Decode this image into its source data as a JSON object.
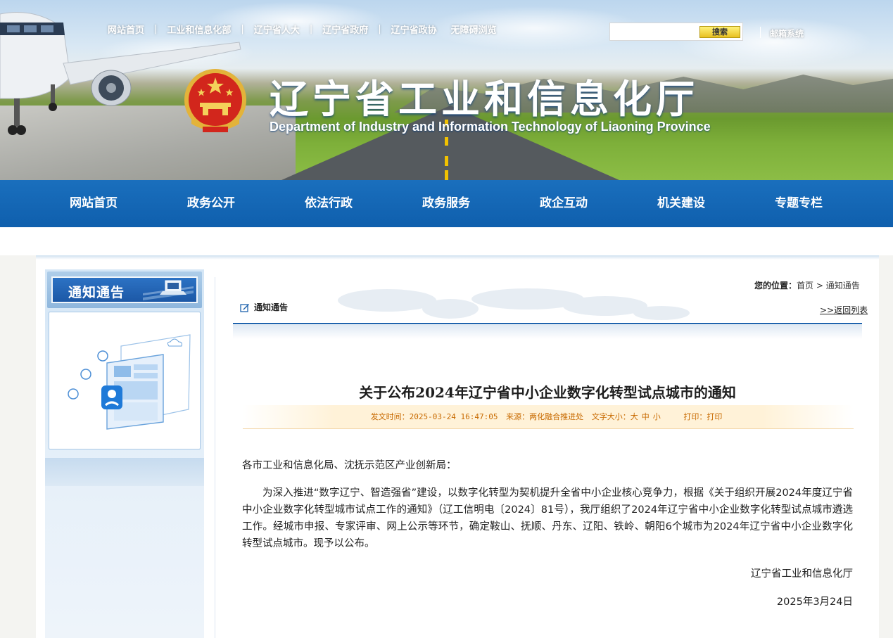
{
  "top_links": [
    "网站首页",
    "工业和信息化部",
    "辽宁省人大",
    "辽宁省政府",
    "辽宁省政协",
    "无障碍浏览"
  ],
  "search": {
    "placeholder": "",
    "button": "搜索"
  },
  "mail_link": "邮箱系统",
  "site_title_cn": "辽宁省工业和信息化厅",
  "site_title_en": "Department of Industry and Information Technology of Liaoning Province",
  "main_nav": [
    "网站首页",
    "政务公开",
    "依法行政",
    "政务服务",
    "政企互动",
    "机关建设",
    "专题专栏"
  ],
  "sidebar": {
    "title": "通知通告"
  },
  "breadcrumb": {
    "label": "您的位置：",
    "home": "首页",
    "sep": ">",
    "current": "通知通告"
  },
  "category": "通知通告",
  "back_link": ">>返回列表",
  "article": {
    "title": "关于公布2024年辽宁省中小企业数字化转型试点城市的通知",
    "meta": {
      "date_label": "发文时间：",
      "date": "2025-03-24 16:47:05",
      "source_label": "来源：",
      "source": "两化融合推进处",
      "size_label": "文字大小：",
      "size_large": "大",
      "size_medium": "中",
      "size_small": "小",
      "print_label": "打印：",
      "print": "打印"
    },
    "salutation": "各市工业和信息化局、沈抚示范区产业创新局：",
    "paragraph": "为深入推进“数字辽宁、智造强省”建设，以数字化转型为契机提升全省中小企业核心竞争力，根据《关于组织开展2024年度辽宁省中小企业数字化转型城市试点工作的通知》（辽工信明电〔2024〕81号），我厅组织了2024年辽宁省中小企业数字化转型试点城市遴选工作。经城市申报、专家评审、网上公示等环节，确定鞍山、抚顺、丹东、辽阳、铁岭、朝阳6个城市为2024年辽宁省中小企业数字化转型试点城市。现予以公布。",
    "signature": "辽宁省工业和信息化厅",
    "sign_date": "2025年3月24日"
  },
  "colors": {
    "nav_blue": "#0f5fad",
    "meta_orange": "#c86a00",
    "rule_blue": "#1f63ad"
  }
}
